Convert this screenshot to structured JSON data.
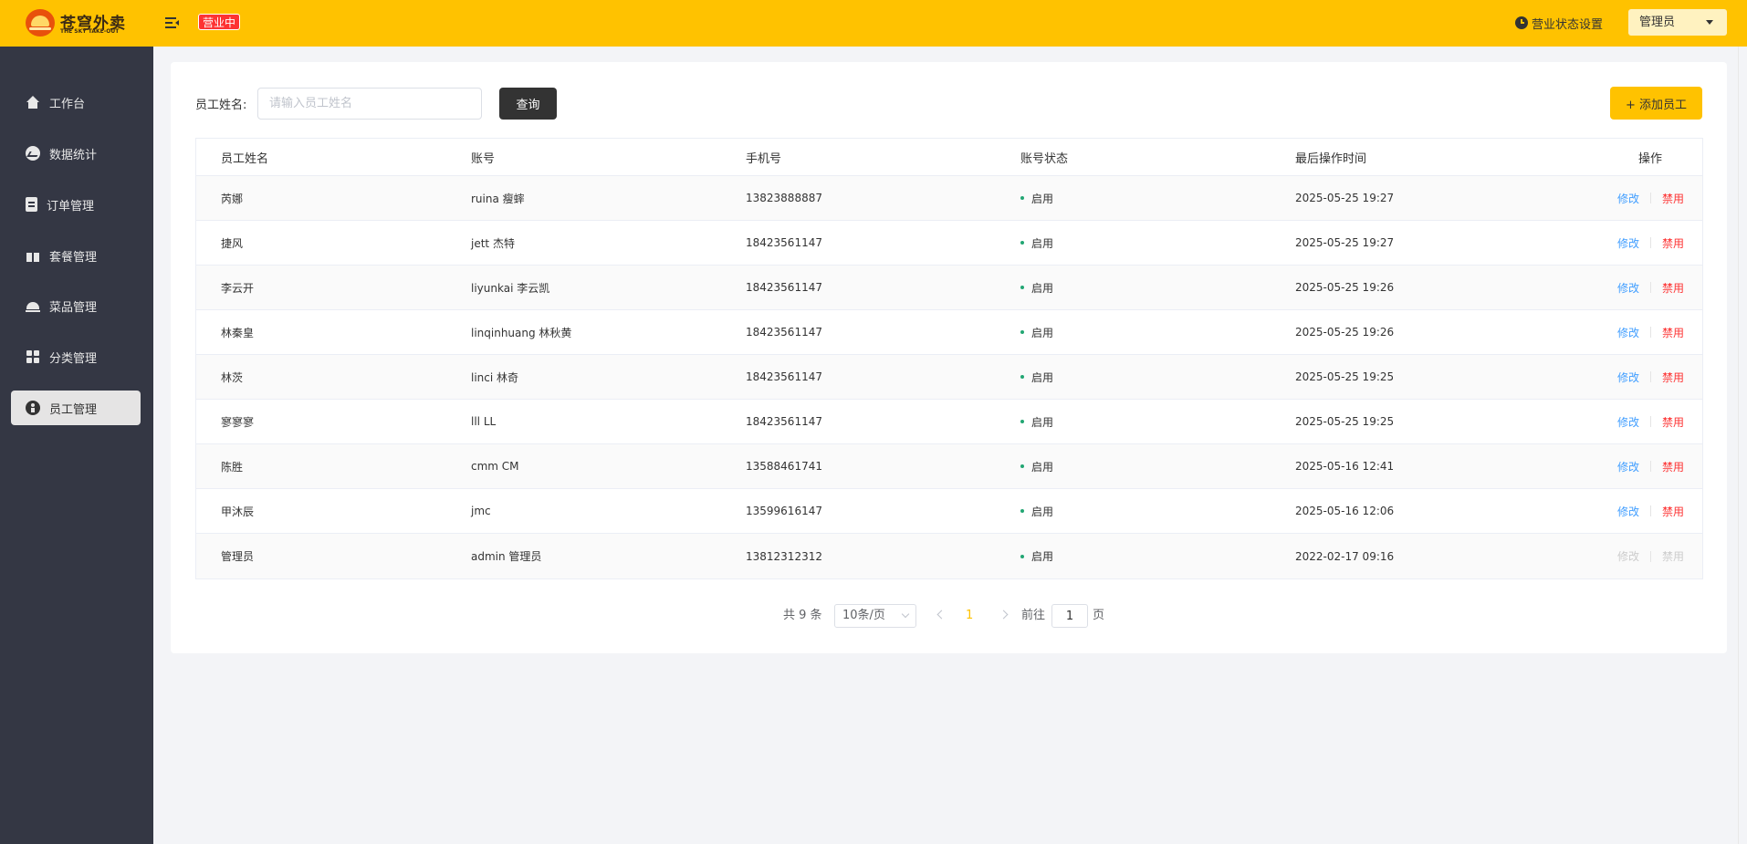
{
  "header": {
    "logo_text": "苍穹外卖",
    "logo_sub": "THE SKY TAKE-OUT",
    "shop_status": "营业中",
    "status_settings": "营业状态设置",
    "user_menu": "管理员",
    "accent_color": "#ffc200"
  },
  "sidebar": {
    "items": [
      {
        "label": "工作台",
        "icon": "home-icon"
      },
      {
        "label": "数据统计",
        "icon": "chart-icon"
      },
      {
        "label": "订单管理",
        "icon": "order-icon"
      },
      {
        "label": "套餐管理",
        "icon": "gift-icon"
      },
      {
        "label": "菜品管理",
        "icon": "dish-icon"
      },
      {
        "label": "分类管理",
        "icon": "grid-icon"
      },
      {
        "label": "员工管理",
        "icon": "staff-icon"
      }
    ],
    "active_index": 6
  },
  "search": {
    "label": "员工姓名:",
    "placeholder": "请输入员工姓名",
    "value": "",
    "query_button": "查询",
    "add_button": "+ 添加员工"
  },
  "table": {
    "columns": [
      "员工姓名",
      "账号",
      "手机号",
      "账号状态",
      "最后操作时间",
      "操作"
    ],
    "rows": [
      {
        "name": "芮娜",
        "account": "ruina 瘦蟀",
        "phone": "13823888887",
        "status": "启用",
        "time": "2025-05-25 19:27",
        "edit": "修改",
        "ban": "禁用"
      },
      {
        "name": "捷风",
        "account": "jett 杰特",
        "phone": "18423561147",
        "status": "启用",
        "time": "2025-05-25 19:27",
        "edit": "修改",
        "ban": "禁用"
      },
      {
        "name": "李云开",
        "account": "liyunkai 李云凯",
        "phone": "18423561147",
        "status": "启用",
        "time": "2025-05-25 19:26",
        "edit": "修改",
        "ban": "禁用"
      },
      {
        "name": "林秦皇",
        "account": "linqinhuang 林秋黄",
        "phone": "18423561147",
        "status": "启用",
        "time": "2025-05-25 19:26",
        "edit": "修改",
        "ban": "禁用"
      },
      {
        "name": "林茨",
        "account": "linci 林奇",
        "phone": "18423561147",
        "status": "启用",
        "time": "2025-05-25 19:25",
        "edit": "修改",
        "ban": "禁用"
      },
      {
        "name": "寥寥寥",
        "account": "lll LL",
        "phone": "18423561147",
        "status": "启用",
        "time": "2025-05-25 19:25",
        "edit": "修改",
        "ban": "禁用"
      },
      {
        "name": "陈胜",
        "account": "cmm CM",
        "phone": "13588461741",
        "status": "启用",
        "time": "2025-05-16 12:41",
        "edit": "修改",
        "ban": "禁用"
      },
      {
        "name": "甲沐辰",
        "account": "jmc",
        "phone": "13599616147",
        "status": "启用",
        "time": "2025-05-16 12:06",
        "edit": "修改",
        "ban": "禁用"
      },
      {
        "name": "管理员",
        "account": "admin 管理员",
        "phone": "13812312312",
        "status": "启用",
        "time": "2022-02-17 09:16",
        "edit": "修改",
        "ban": "禁用"
      }
    ]
  },
  "pagination": {
    "total": "共 9 条",
    "page_size": "10条/页",
    "current_page": "1",
    "goto_label": "前往",
    "goto_value": "1",
    "page_suffix": "页"
  }
}
